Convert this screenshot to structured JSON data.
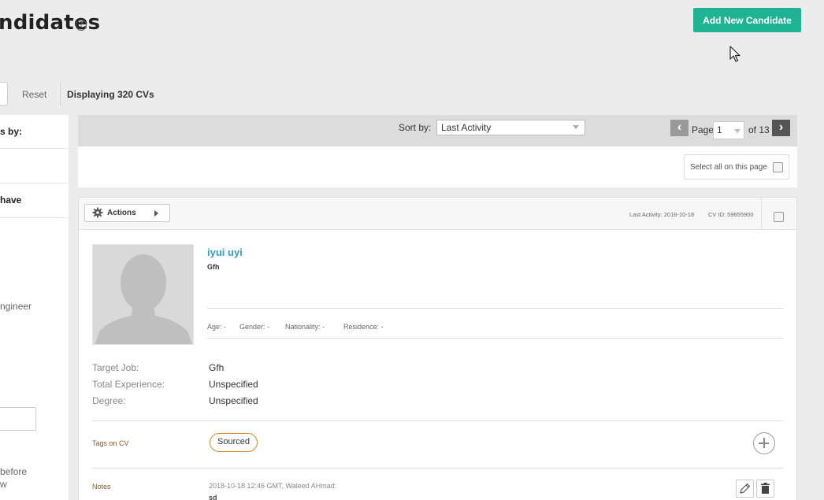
{
  "header": {
    "title": "ndidates",
    "help_glyph": "?",
    "add_button_label": "Add New Candidate"
  },
  "toolbar": {
    "reset_label": "Reset",
    "display_count": "Displaying 320 CVs"
  },
  "filters": {
    "heading": "s by:",
    "have_label": "have",
    "engineer_label": "ngineer",
    "before_label": "before\nw"
  },
  "list": {
    "sort_label": "Sort by:",
    "sort_value": "Last Activity",
    "prev_glyph": "‹",
    "next_glyph": "›",
    "page_label": "Page",
    "page_value": "1",
    "page_total": "of 13",
    "select_all_label": "Select all on this page"
  },
  "candidate": {
    "actions_label": "Actions",
    "last_activity": "Last Activity: 2018-10-18",
    "cv_id": "CV ID: 59655900",
    "name": "iyui uyi",
    "title": "Gfh",
    "age": "Age: -",
    "gender": "Gender: -",
    "nationality": "Nationality: -",
    "residence": "Residence: -",
    "details": {
      "target_job_label": "Target Job:",
      "target_job_value": "Gfh",
      "experience_label": "Total Experience:",
      "experience_value": "Unspecified",
      "degree_label": "Degree:",
      "degree_value": "Unspecified"
    },
    "tags_label": "Tags on CV",
    "tags": [
      "Sourced"
    ],
    "notes_label": "Notes",
    "note_meta": "2018-10-18 12:46 GMT, Waleed AHmad:",
    "note_text": "sd"
  },
  "colors": {
    "accent": "#1fb394",
    "link": "#2e9fc9",
    "tag_border": "#d4892a"
  }
}
